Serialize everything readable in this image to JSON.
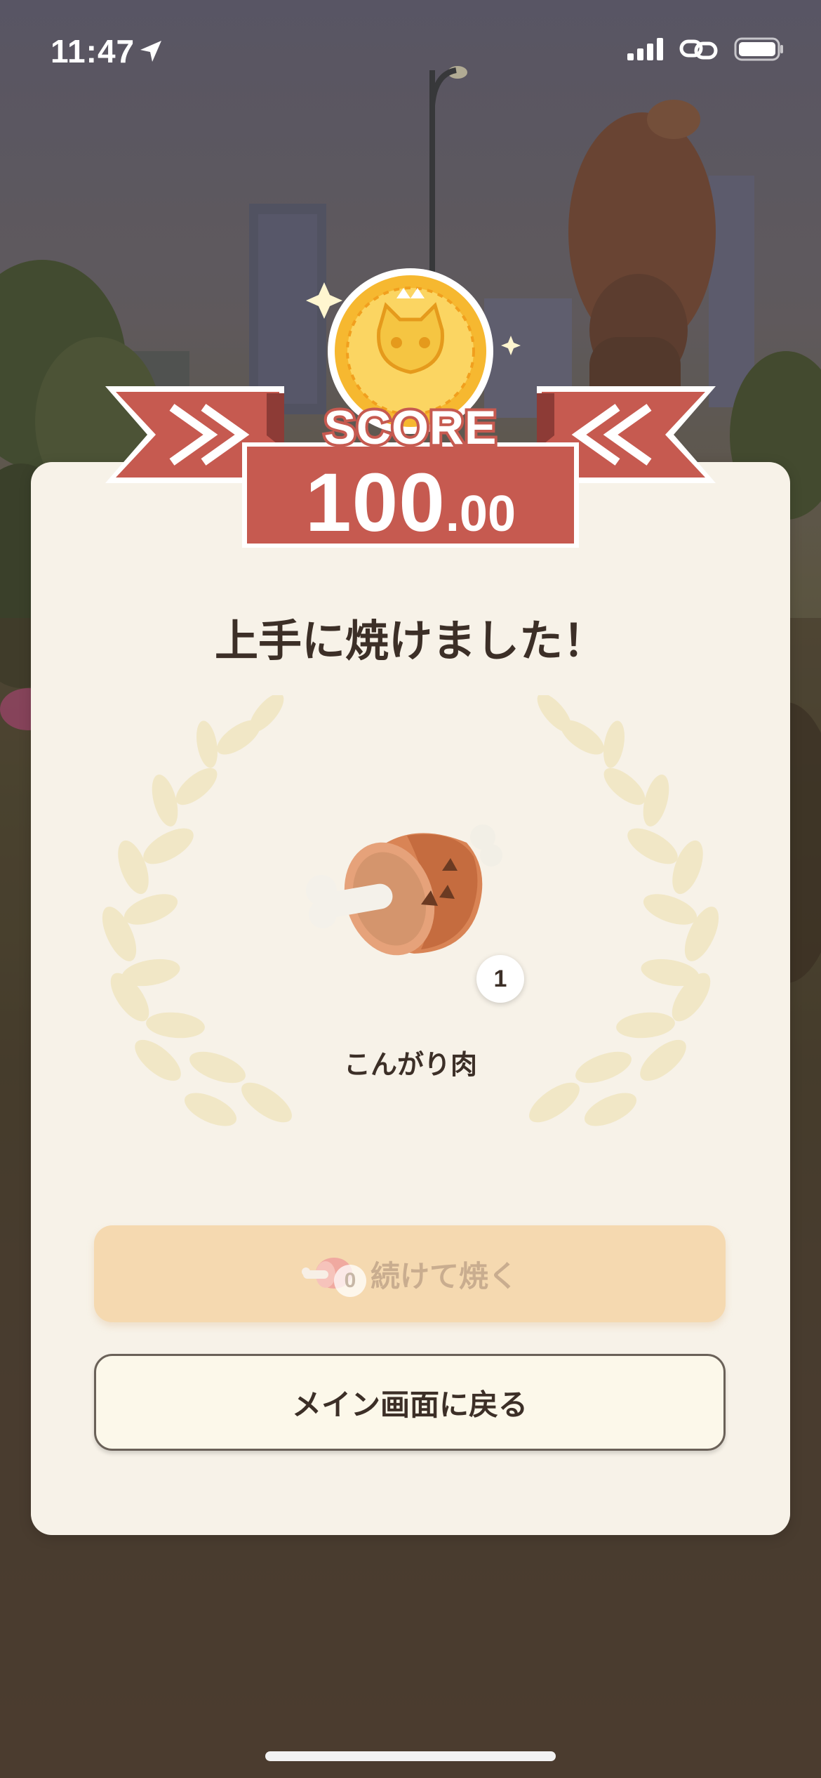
{
  "status_bar": {
    "time": "11:47",
    "icons": [
      "location-arrow-icon",
      "cellular-signal-icon",
      "personal-hotspot-icon",
      "battery-icon"
    ]
  },
  "score": {
    "label": "SCORE",
    "integer": "100",
    "decimal": ".00",
    "medal_icon": "cat-face-coin-icon"
  },
  "result": {
    "title": "上手に焼けました！",
    "item_name": "こんがり肉",
    "item_icon": "roasted-meat-icon",
    "item_count": "1"
  },
  "buttons": {
    "continue_label": "続けて焼く",
    "continue_count": "0",
    "main_label": "メイン画面に戻る"
  },
  "colors": {
    "banner_red": "#c65a50",
    "card_bg": "#f7f2e8",
    "coin_gold": "#f6b830",
    "continue_bg": "#f5d9b0",
    "text_dark": "#3c2f27"
  }
}
